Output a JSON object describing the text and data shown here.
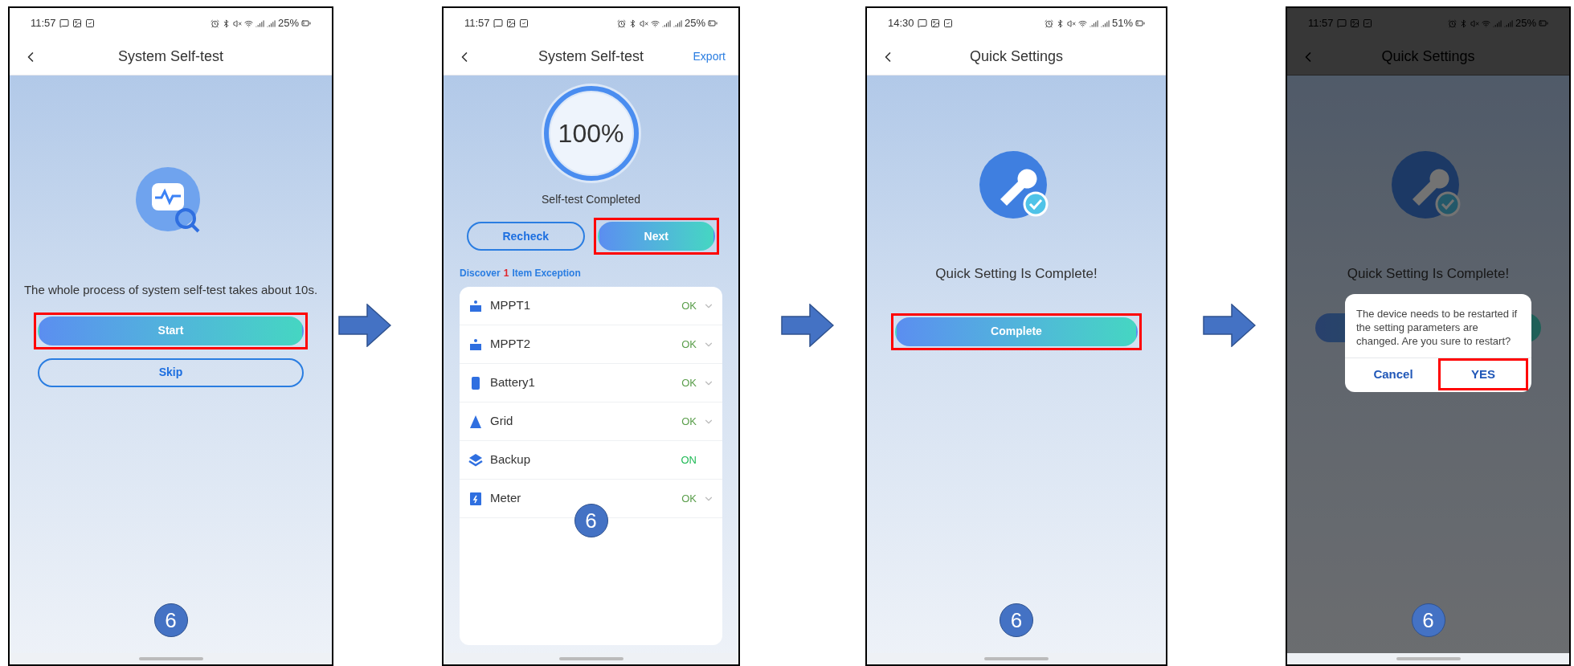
{
  "screens": [
    {
      "kind": "start",
      "status_bar": {
        "time": "11:57",
        "battery": "25%"
      },
      "header": {
        "title": "System Self-test"
      },
      "message": "The whole process of system self-test takes about 10s.",
      "buttons": [
        {
          "label": "Start",
          "kind": "primary",
          "highlighted": true
        },
        {
          "label": "Skip",
          "kind": "secondary",
          "highlighted": false
        }
      ],
      "step": "6"
    },
    {
      "kind": "result",
      "status_bar": {
        "time": "11:57",
        "battery": "25%"
      },
      "header": {
        "title": "System Self-test",
        "action": "Export"
      },
      "progress": {
        "level": 1,
        "reading": "100%"
      },
      "status": "Self-test Completed",
      "buttons": [
        {
          "label": "Recheck",
          "kind": "secondary",
          "highlighted": false
        },
        {
          "label": "Next",
          "kind": "primary",
          "highlighted": true
        }
      ],
      "summary": {
        "prefix": "Discover",
        "count": "1",
        "suffix": "Item Exception"
      },
      "items": [
        {
          "kind": "solar",
          "name": "MPPT1",
          "status": "OK",
          "color": "#5a9e4b",
          "expandable": true
        },
        {
          "kind": "solar",
          "name": "MPPT2",
          "status": "OK",
          "color": "#5a9e4b",
          "expandable": true
        },
        {
          "kind": "battery",
          "name": "Battery1",
          "status": "OK",
          "color": "#5a9e4b",
          "expandable": true
        },
        {
          "kind": "grid",
          "name": "Grid",
          "status": "OK",
          "color": "#5a9e4b",
          "expandable": true
        },
        {
          "kind": "backup",
          "name": "Backup",
          "status": "ON",
          "color": "#1db954",
          "expandable": false
        },
        {
          "kind": "meter",
          "name": "Meter",
          "status": "OK",
          "color": "#5a9e4b",
          "expandable": true
        }
      ],
      "step": "6"
    },
    {
      "kind": "complete",
      "status_bar": {
        "time": "14:30",
        "battery": "51%"
      },
      "header": {
        "title": "Quick Settings"
      },
      "message": "Quick Setting Is Complete!",
      "buttons": [
        {
          "label": "Complete",
          "kind": "primary",
          "highlighted": true
        }
      ],
      "step": "6"
    },
    {
      "kind": "dialog",
      "status_bar": {
        "time": "11:57",
        "battery": "25%"
      },
      "header": {
        "title": "Quick Settings"
      },
      "message": "Quick Setting Is Complete!",
      "dialog": {
        "message": "The device needs to be restarted if the setting parameters are changed. Are you sure to restart?",
        "buttons": [
          {
            "label": "Cancel",
            "highlighted": false
          },
          {
            "label": "YES",
            "highlighted": true
          }
        ]
      },
      "step": "6"
    }
  ]
}
